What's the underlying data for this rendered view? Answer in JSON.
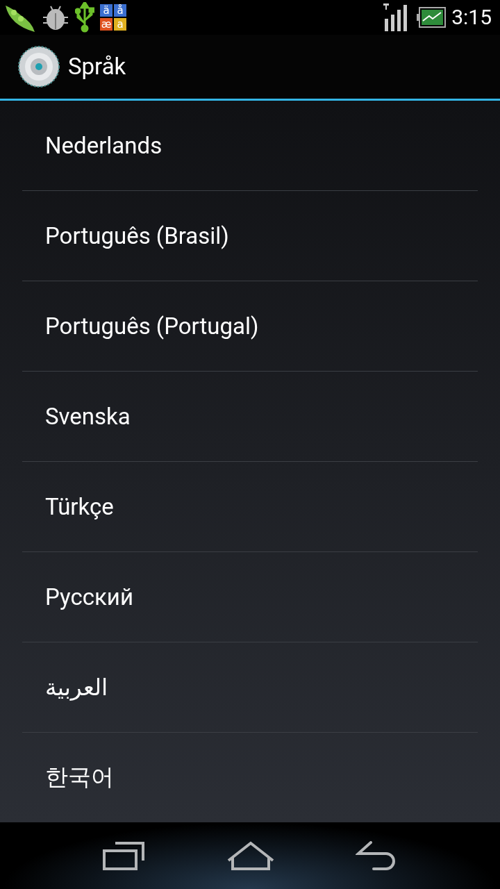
{
  "status_bar": {
    "app_icon_letters": [
      "ä",
      "å",
      "æ",
      "a"
    ],
    "time": "3:15"
  },
  "action_bar": {
    "title": "Språk"
  },
  "languages": [
    {
      "label": "Nederlands"
    },
    {
      "label": "Português (Brasil)"
    },
    {
      "label": "Português (Portugal)"
    },
    {
      "label": "Svenska"
    },
    {
      "label": "Türkçe"
    },
    {
      "label": "Русский"
    },
    {
      "label": "العربية"
    },
    {
      "label": "한국어"
    }
  ]
}
